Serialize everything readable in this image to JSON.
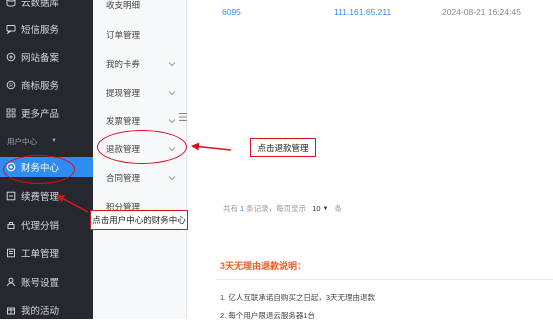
{
  "sidebar": {
    "items": [
      {
        "label": "云数据库",
        "icon": "database-icon"
      },
      {
        "label": "短信服务",
        "icon": "message-icon"
      },
      {
        "label": "网站备案",
        "icon": "record-icon"
      },
      {
        "label": "商标服务",
        "icon": "trademark-icon"
      },
      {
        "label": "更多产品",
        "icon": "grid-icon"
      }
    ],
    "group_label": "用户中心",
    "user_items": [
      {
        "label": "财务中心",
        "icon": "finance-icon",
        "active": true
      },
      {
        "label": "续费管理",
        "icon": "renew-icon"
      },
      {
        "label": "代理分销",
        "icon": "agent-icon"
      },
      {
        "label": "工单管理",
        "icon": "ticket-icon"
      },
      {
        "label": "账号设置",
        "icon": "user-icon"
      },
      {
        "label": "我的活动",
        "icon": "activity-icon"
      }
    ]
  },
  "submenu": {
    "items": [
      {
        "label": "收支明细"
      },
      {
        "label": "订单管理"
      },
      {
        "label": "我的卡券"
      },
      {
        "label": "提现管理"
      },
      {
        "label": "发票管理"
      },
      {
        "label": "退款管理"
      },
      {
        "label": "合同管理"
      },
      {
        "label": "积分管理"
      }
    ]
  },
  "table": {
    "row": {
      "id": "6095",
      "ip": "111.161.65.211",
      "time": "2024-08-21 16:24:45"
    }
  },
  "pager": {
    "prefix": "共有",
    "count": "1",
    "middle": "条记录，每页显示",
    "per_page": "10",
    "suffix": "条"
  },
  "refund": {
    "title": "3天无理由退款说明：",
    "lines": [
      "1. 亿人互联承诺自购买之日起，3天无理由退款",
      "2. 每个用户限退云服务器1台"
    ]
  },
  "annotations": {
    "refund_hint": "点击退款管理",
    "finance_hint": "点击用户中心的财务中心"
  },
  "colors": {
    "accent": "#2f8cf0",
    "highlight": "#d4141b",
    "refund_title": "#f05a28"
  }
}
